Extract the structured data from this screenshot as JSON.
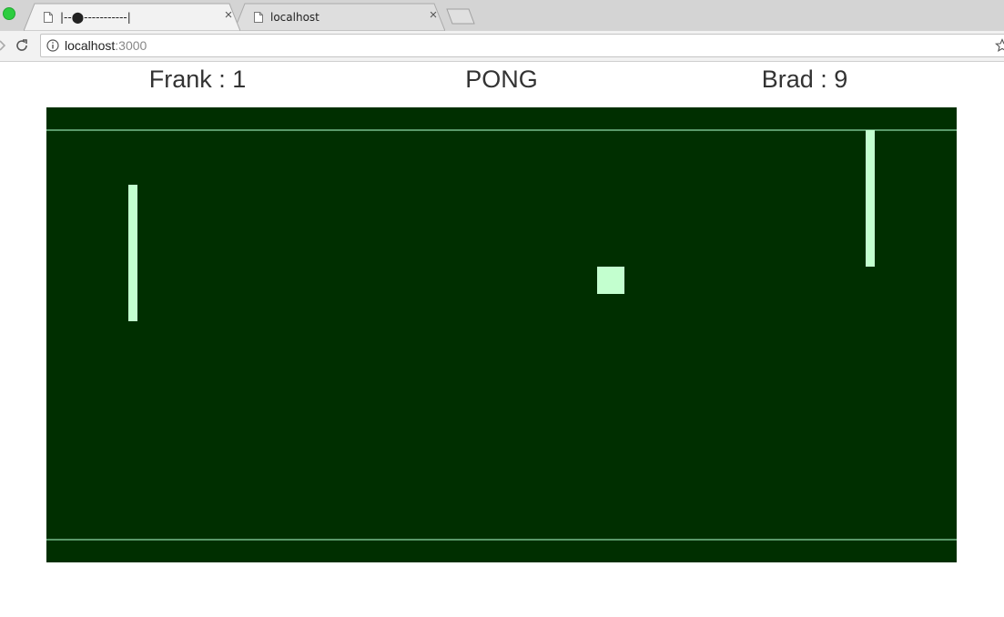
{
  "browser": {
    "tabs": [
      {
        "title": "|--⬤-----------|",
        "active": true
      },
      {
        "title": "localhost",
        "active": false
      }
    ],
    "address": {
      "host": "localhost",
      "port": ":3000"
    },
    "icons": {
      "traffic_light": "green-circle",
      "tab_icon": "page-icon",
      "tab_close": "×",
      "forward": "chevron-right-icon",
      "reload": "reload-icon",
      "site_info": "info-icon",
      "bookmark": "star-icon"
    }
  },
  "game": {
    "title": "PONG",
    "separator": " : ",
    "players": {
      "left": {
        "name": "Frank",
        "score": "1"
      },
      "right": {
        "name": "Brad",
        "score": "9"
      }
    },
    "colors": {
      "court": "#002f00",
      "walls": "#5a9a6a",
      "paddles": "#c3ffcf",
      "ball": "#c3ffcf",
      "score_text": "#333333"
    }
  }
}
